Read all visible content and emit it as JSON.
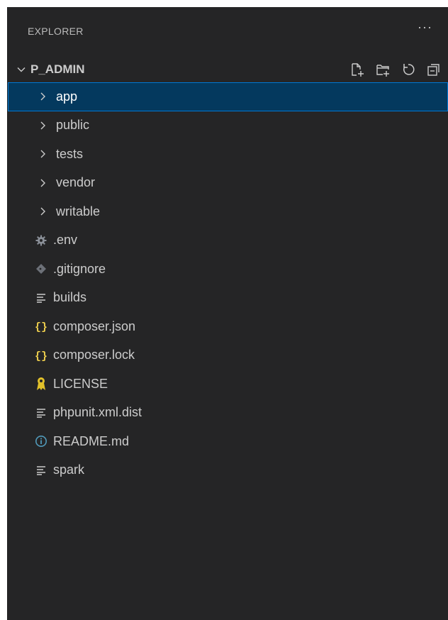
{
  "explorer": {
    "title": "EXPLORER",
    "more_label": "···"
  },
  "section": {
    "title": "P_ADMIN",
    "actions": [
      "new-file-icon",
      "new-folder-icon",
      "refresh-icon",
      "collapse-all-icon"
    ]
  },
  "tree": {
    "items": [
      {
        "label": "app",
        "kind": "folder",
        "selected": true
      },
      {
        "label": "public",
        "kind": "folder"
      },
      {
        "label": "tests",
        "kind": "folder"
      },
      {
        "label": "vendor",
        "kind": "folder"
      },
      {
        "label": "writable",
        "kind": "folder"
      },
      {
        "label": ".env",
        "kind": "file",
        "icon": "gear-icon"
      },
      {
        "label": ".gitignore",
        "kind": "file",
        "icon": "git-diamond-icon"
      },
      {
        "label": "builds",
        "kind": "file",
        "icon": "text-lines-icon"
      },
      {
        "label": "composer.json",
        "kind": "file",
        "icon": "json-braces-icon"
      },
      {
        "label": "composer.lock",
        "kind": "file",
        "icon": "json-braces-icon"
      },
      {
        "label": "LICENSE",
        "kind": "file",
        "icon": "license-ribbon-icon"
      },
      {
        "label": "phpunit.xml.dist",
        "kind": "file",
        "icon": "text-lines-icon"
      },
      {
        "label": "README.md",
        "kind": "file",
        "icon": "info-icon"
      },
      {
        "label": "spark",
        "kind": "file",
        "icon": "text-lines-icon"
      }
    ]
  },
  "colors": {
    "panel_bg": "#252526",
    "selected_bg": "#04395e",
    "selected_border": "#0078d4",
    "json_icon": "#f1d14e",
    "license_icon": "#e2c12a",
    "info_icon": "#519aba",
    "gear_icon": "#8b9098",
    "git_icon": "#6d7178"
  }
}
